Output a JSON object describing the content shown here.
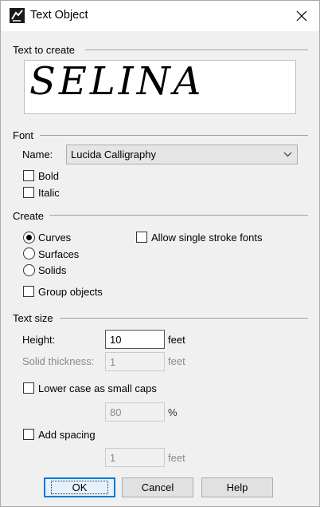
{
  "window": {
    "title": "Text Object"
  },
  "text_to_create": {
    "group_label": "Text to create",
    "preview_text": "SELINA"
  },
  "font": {
    "group_label": "Font",
    "name_label": "Name:",
    "name_value": "Lucida Calligraphy",
    "bold_label": "Bold",
    "bold_checked": false,
    "italic_label": "Italic",
    "italic_checked": false
  },
  "create": {
    "group_label": "Create",
    "options": [
      {
        "label": "Curves",
        "selected": true
      },
      {
        "label": "Surfaces",
        "selected": false
      },
      {
        "label": "Solids",
        "selected": false
      }
    ],
    "single_stroke_label": "Allow single stroke fonts",
    "single_stroke_checked": false,
    "group_objects_label": "Group objects",
    "group_objects_checked": false
  },
  "text_size": {
    "group_label": "Text size",
    "height_label": "Height:",
    "height_value": "10",
    "height_unit": "feet",
    "solid_thickness_label": "Solid thickness:",
    "solid_thickness_value": "1",
    "solid_thickness_unit": "feet",
    "small_caps_label": "Lower case as small caps",
    "small_caps_checked": false,
    "small_caps_value": "80",
    "small_caps_unit": "%",
    "spacing_label": "Add spacing",
    "spacing_checked": false,
    "spacing_value": "1",
    "spacing_unit": "feet"
  },
  "buttons": {
    "ok": "OK",
    "cancel": "Cancel",
    "help": "Help"
  }
}
